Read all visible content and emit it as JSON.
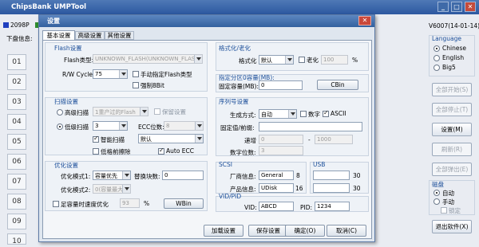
{
  "app": {
    "title": "ChipsBank UMPTool"
  },
  "main_window": {
    "legend_1": "2098P",
    "version": "V6007(14-01-14)",
    "disk_info_label": "下盘信息:",
    "slots": [
      "01",
      "02",
      "03",
      "04",
      "05",
      "06",
      "07",
      "08",
      "09",
      "10",
      "11",
      "12"
    ]
  },
  "right_panel": {
    "language_title": "Language",
    "languages": [
      "Chinese",
      "English",
      "Big5"
    ],
    "selected_language": "Chinese",
    "buttons": {
      "start_all": "全部开始(S)",
      "stop_all": "全部停止(T)",
      "settings": "设置(M)",
      "refresh": "刷新(R)",
      "eject_all": "全部弹出(E)",
      "exit": "退出软件(X)"
    },
    "disk_title": "磁盘",
    "disk_modes": [
      "自动",
      "手动"
    ],
    "lock_label": "锁定",
    "selected_disk_mode": "自动"
  },
  "dialog": {
    "title": "设置",
    "close_glyph": "✕",
    "tabs": [
      "基本设置",
      "高级设置",
      "其他设置"
    ],
    "flash": {
      "section": "Flash设置",
      "type_label": "Flash类型:",
      "type_value": "UNKNOWN_FLASH(UNKNOWN_FLASH)",
      "rw_label": "R/W Cycle:",
      "rw_value": "75",
      "manual_type_label": "手动指定Flash类型",
      "force_8bit_label": "强制8Bit"
    },
    "scan": {
      "section": "扫描设置",
      "high_label": "高级扫描",
      "high_value": "1重产过的Flash",
      "keep_label": "保留设置",
      "low_label": "低级扫描",
      "low_value": "3",
      "ecc_label": "ECC位数:",
      "ecc_value": "8",
      "smart_label": "智能扫描",
      "smart_value": "默认",
      "lowfmt_label": "低格前擦除",
      "auto_ecc_label": "Auto ECC"
    },
    "optimize": {
      "section": "优化设置",
      "opt1_label": "优化模式1:",
      "opt1_value": "容量优先",
      "replace_label": "替换块数:",
      "replace_value": "0",
      "opt2_label": "优化模式2:",
      "opt2_value": "0(容量最大",
      "full_label": "足容量时速度优化",
      "full_value": "93",
      "percent": "%",
      "wbin_label": "WBin"
    },
    "format": {
      "section": "格式化/老化",
      "format_label": "格式化",
      "format_value": "默认",
      "aging_label": "老化",
      "aging_value": "100",
      "percent": "%"
    },
    "partition": {
      "section": "指定分区0容量(MB):",
      "fixed_label": "固定容量(MB):",
      "fixed_value": "0",
      "cbin_label": "CBin"
    },
    "serial": {
      "section": "序列号设置",
      "gen_label": "生成方式:",
      "gen_value": "自动",
      "digit_label": "数字",
      "ascii_label": "ASCII",
      "prefix_label": "固定值/前缀:",
      "step_label": "递增",
      "step_from": "0",
      "dash": "-",
      "step_to": "1000",
      "digits_label": "数字位数:",
      "digits_value": "3"
    },
    "scsi": {
      "section": "SCSI",
      "vendor_label": "厂商信息:",
      "vendor_value": "General",
      "vendor_len": "8",
      "product_label": "产品信息:",
      "product_value": "UDisk",
      "product_len": "16"
    },
    "usb": {
      "section": "USB",
      "len1": "30",
      "len2": "30"
    },
    "vidpid": {
      "section": "VID/PID",
      "vid_label": "VID:",
      "vid_value": "ABCD",
      "pid_label": "PID:",
      "pid_value": "1234"
    },
    "buttons": {
      "load": "加载设置",
      "save": "保存设置",
      "ok": "确定(O)",
      "cancel": "取消(C)"
    }
  },
  "colors": {
    "titlebar": "#2c58a0",
    "legend_1": "#1f3fbf",
    "legend_2": "#2f8d2f",
    "accent": "#1c4f9a"
  }
}
